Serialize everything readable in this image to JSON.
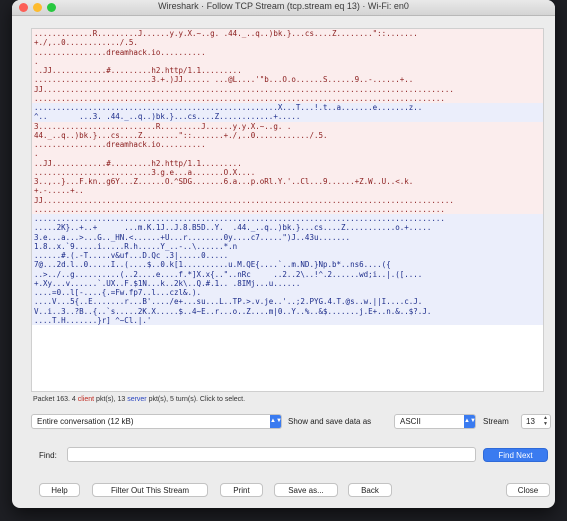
{
  "window": {
    "title": "Wireshark · Follow TCP Stream (tcp.stream eq 13) · Wi-Fi: en0"
  },
  "stream_lines": [
    {
      "t": ".............R.........J......y.y.X.~..g. .44._..q..)bk.}...cs....Z........\"::.......",
      "k": "c"
    },
    {
      "t": "+./,..0............/.5.",
      "k": "c"
    },
    {
      "t": "................dreamhack.io..........",
      "k": "c"
    },
    {
      "t": ".",
      "k": "c"
    },
    {
      "t": "..JJ............#.........h2.http/1.1.........",
      "k": "c"
    },
    {
      "t": "..........................3.+.)JJ...... ...@L....'\"b...O.o......S......9..-......+..",
      "k": "c"
    },
    {
      "t": "JJ...........................................................................................",
      "k": "c"
    },
    {
      "t": "...........................................................................................",
      "k": "c"
    },
    {
      "t": "......................................................X...T...!.t..a.......e.......z..",
      "k": "s"
    },
    {
      "t": "^..       ...3. .44._..q..)bk.}...cs....Z............+.....",
      "k": "s"
    },
    {
      "t": "3..........................R.........J......y.y.X.~..g. .",
      "k": "c"
    },
    {
      "t": "44._..q..)bk.}...cs....Z........\"::.......+./,..0............/.5.",
      "k": "c"
    },
    {
      "t": "................dreamhack.io..........",
      "k": "c"
    },
    {
      "t": ".",
      "k": "c"
    },
    {
      "t": "..JJ............#.........h2.http/1.1.........",
      "k": "c"
    },
    {
      "t": "..........................3.g.e...a.......O.X....",
      "k": "c"
    },
    {
      "t": "3..,..}...F.kn..g6Y...Z......O.^SDG.......6.a...p.oRl.Y.'..Cl...9......+Z.W..U..<.k.",
      "k": "c"
    },
    {
      "t": "+.-.....+..",
      "k": "c"
    },
    {
      "t": "JJ...........................................................................................",
      "k": "c"
    },
    {
      "t": "...........................................................................................",
      "k": "c"
    },
    {
      "t": "...........................................................................................",
      "k": "s"
    },
    {
      "t": ".....2K}..+..+      ...m.K.1J..J.8.B5D..Y.  .44._..q..)bk.}...cs....Z...........o.+.....",
      "k": "s"
    },
    {
      "t": "3.e...a...>...G.._HN.<......+U...r........0y....c7.....\")J..43u.......",
      "k": "s"
    },
    {
      "t": "1.8..x.`9.....i.....R.h.....Y_..-..\\......*.n",
      "k": "s"
    },
    {
      "t": "......#.(.-T.....v&uf...D.Qc .3|.....0.....",
      "k": "s"
    },
    {
      "t": "7@...2d.l..0.....I..(....$..0.k[1..........u.M.QE{....`..m.ND.}Np.b*..ns6....({",
      "k": "s"
    },
    {
      "t": "..>../..g..........(..2....e....f.*]X.x{..\"..nRc     ..2..2\\..!^.2......wd;i..|.([....",
      "k": "s"
    },
    {
      "t": "+.Xy...v......`.UX..F.$1N...k..2k\\..Q.#.1.. .8IMj...u......",
      "k": "s"
    },
    {
      "t": "....=0..l[-....{.=Fw.fp7..l...czl&.).",
      "k": "s"
    },
    {
      "t": "....V...5{..E.......r...B'..../e+...su...L..TP.>.v.je..'..;2.PYG.4.T.@s..w.||I....c.J.",
      "k": "s"
    },
    {
      "t": "V..i..3..?B..{..`s.....2K.X.....$..4~E..r...o..Z....m|0..Y..%..&$.......j.E+..n.&..$?.J.",
      "k": "s"
    },
    {
      "t": "....T.H.......}r] ^~Cl.|.'",
      "k": "s"
    }
  ],
  "status": {
    "prefix": "Packet 163. 4 ",
    "client": "client",
    "middle": " pkt(s), 13 ",
    "server": "server",
    "suffix": " pkt(s), 5 turn(s). Click to select."
  },
  "conversation_select": {
    "value": "Entire conversation (12 kB)"
  },
  "show_as": {
    "label": "Show and save data as",
    "value": "ASCII"
  },
  "stream_num": {
    "label": "Stream",
    "value": "13"
  },
  "find": {
    "label": "Find:",
    "value": "",
    "button": "Find Next"
  },
  "buttons": {
    "help": "Help",
    "filter_out": "Filter Out This Stream",
    "print": "Print",
    "save_as": "Save as...",
    "back": "Back",
    "close": "Close"
  },
  "colors": {
    "client_bg": "#fbeded",
    "client_fg": "#8a1c1c",
    "server_bg": "#ebeefb",
    "server_fg": "#1c2c8a",
    "accent": "#3a7bf0"
  }
}
